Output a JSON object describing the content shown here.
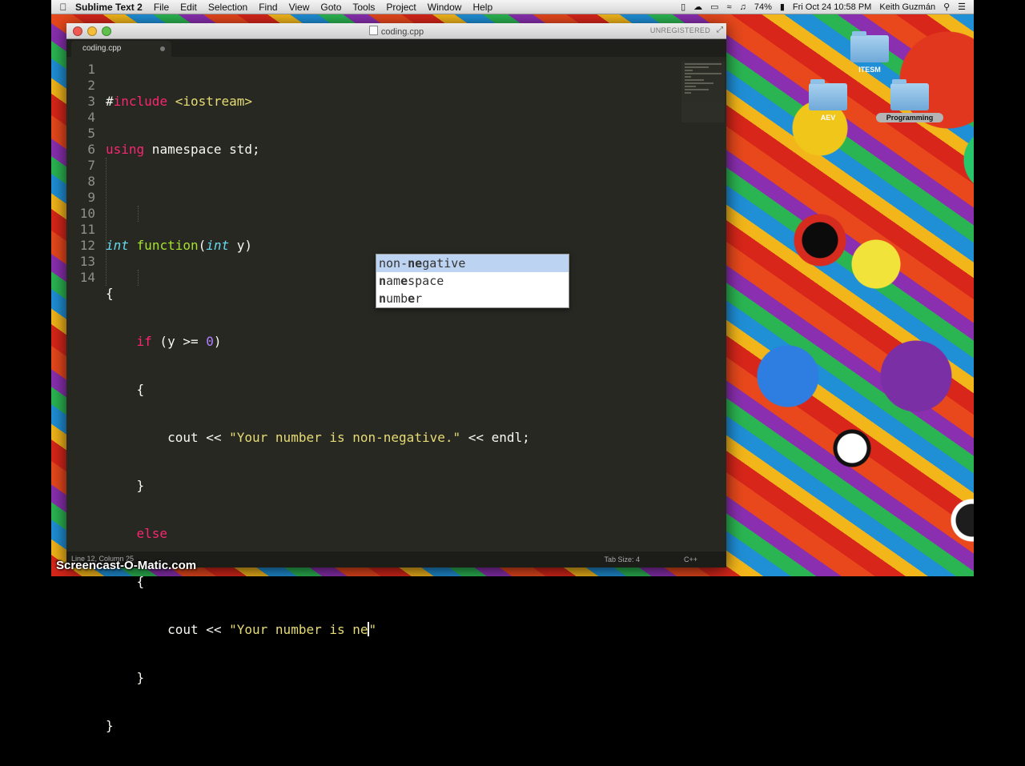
{
  "menubar": {
    "app_name": "Sublime Text 2",
    "items": [
      "File",
      "Edit",
      "Selection",
      "Find",
      "View",
      "Goto",
      "Tools",
      "Project",
      "Window",
      "Help"
    ],
    "battery": "74%",
    "datetime": "Fri Oct 24  10:58 PM",
    "user": "Keith Guzmán"
  },
  "window": {
    "title": "coding.cpp",
    "unregistered": "UNREGISTERED",
    "tab_label": "coding.cpp"
  },
  "editor": {
    "line_numbers": [
      "1",
      "2",
      "3",
      "4",
      "5",
      "6",
      "7",
      "8",
      "9",
      "10",
      "11",
      "12",
      "13",
      "14"
    ],
    "lines": {
      "l1_hash": "#",
      "l1_include": "include",
      "l1_rest": " <iostream>",
      "l2_using": "using",
      "l2_rest": " namespace std;",
      "l4_int": "int",
      "l4_space": " ",
      "l4_fn": "function",
      "l4_paren": "(",
      "l4_int2": "int",
      "l4_rest": " y)",
      "l5": "{",
      "l6_indent": "    ",
      "l6_if": "if",
      "l6_mid": " (y >= ",
      "l6_num": "0",
      "l6_end": ")",
      "l7": "    {",
      "l8_pre": "        cout << ",
      "l8_str": "\"Your number is non-negative.\"",
      "l8_post": " << endl;",
      "l9": "    }",
      "l10_indent": "    ",
      "l10_else": "else",
      "l11": "    {",
      "l12_pre": "        cout << ",
      "l12_str": "\"Your number is ne",
      "l12_str_end": "\"",
      "l13": "    }",
      "l14": "}"
    }
  },
  "autocomplete": [
    {
      "pre": "non-",
      "match": "ne",
      "post": "gative",
      "selected": true
    },
    {
      "pre": "",
      "match": "n",
      "mid": "am",
      "match2": "e",
      "post": "space",
      "selected": false
    },
    {
      "pre": "",
      "match": "n",
      "mid": "umb",
      "match2": "e",
      "post": "r",
      "selected": false
    }
  ],
  "statusbar": {
    "position": "Line 12, Column 25",
    "tab_size": "Tab Size: 4",
    "syntax": "C++"
  },
  "desktop_icons": [
    {
      "label": "ITESM"
    },
    {
      "label": "AEV"
    },
    {
      "label": "Programming"
    }
  ],
  "watermark": "Screencast-O-Matic.com",
  "colors": {
    "editor_bg": "#272822",
    "keyword": "#f92672",
    "type": "#66d9ef",
    "function": "#a6e22e",
    "string": "#e6db74",
    "number": "#ae81ff",
    "autocomplete_selected": "#bcd3f2"
  }
}
